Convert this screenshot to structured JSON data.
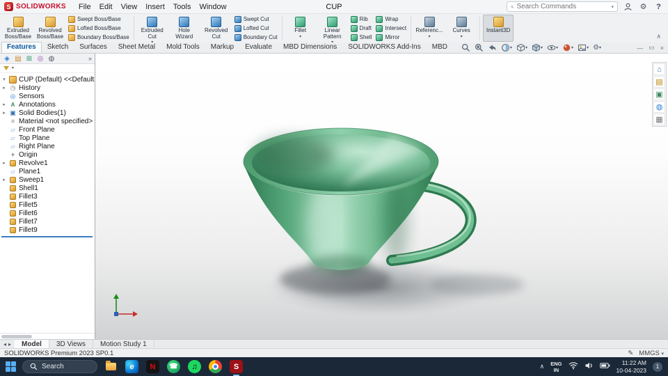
{
  "titlebar": {
    "app_name": "SOLIDWORKS",
    "menus": [
      "File",
      "Edit",
      "View",
      "Insert",
      "Tools",
      "Window"
    ],
    "doc_title": "CUP",
    "search_placeholder": "Search Commands",
    "help_label": "?"
  },
  "ribbon": {
    "large": {
      "extruded_boss": "Extruded Boss/Base",
      "revolved_boss": "Revolved Boss/Base",
      "extruded_cut": "Extruded Cut",
      "hole_wizard": "Hole Wizard",
      "revolved_cut": "Revolved Cut",
      "fillet": "Fillet",
      "linear_pattern": "Linear Pattern",
      "reference": "Referenc...",
      "curves": "Curves",
      "instant3d": "Instant3D"
    },
    "small": {
      "swept_boss": "Swept Boss/Base",
      "lofted_boss": "Lofted Boss/Base",
      "boundary_boss": "Boundary Boss/Base",
      "swept_cut": "Swept Cut",
      "lofted_cut": "Lofted Cut",
      "boundary_cut": "Boundary Cut",
      "rib": "Rib",
      "draft": "Draft",
      "shell": "Shell",
      "wrap": "Wrap",
      "intersect": "Intersect",
      "mirror": "Mirror"
    }
  },
  "tabs": {
    "items": [
      "Features",
      "Sketch",
      "Surfaces",
      "Sheet Metal",
      "Mold Tools",
      "Markup",
      "Evaluate",
      "MBD Dimensions",
      "SOLIDWORKS Add-Ins",
      "MBD"
    ]
  },
  "tree": {
    "root": "CUP (Default) <<Default>_Display St...",
    "items": [
      {
        "e": "▸",
        "t": "History"
      },
      {
        "e": "",
        "t": "Sensors"
      },
      {
        "e": "▸",
        "t": "Annotations"
      },
      {
        "e": "▸",
        "t": "Solid Bodies(1)"
      },
      {
        "e": "",
        "t": "Material <not specified>"
      },
      {
        "e": "",
        "t": "Front Plane"
      },
      {
        "e": "",
        "t": "Top Plane"
      },
      {
        "e": "",
        "t": "Right Plane"
      },
      {
        "e": "",
        "t": "Origin"
      },
      {
        "e": "▸",
        "t": "Revolve1"
      },
      {
        "e": "",
        "t": "Plane1"
      },
      {
        "e": "▸",
        "t": "Sweep1"
      },
      {
        "e": "",
        "t": "Shell1"
      },
      {
        "e": "",
        "t": "Fillet3"
      },
      {
        "e": "",
        "t": "Fillet5"
      },
      {
        "e": "",
        "t": "Fillet6"
      },
      {
        "e": "",
        "t": "Fillet7"
      },
      {
        "e": "",
        "t": "Fillet9"
      }
    ]
  },
  "bottom_tabs": {
    "items": [
      "Model",
      "3D Views",
      "Motion Study 1"
    ]
  },
  "statusbar": {
    "left": "SOLIDWORKS Premium 2023 SP0.1",
    "units": "MMGS"
  },
  "taskbar": {
    "search_label": "Search",
    "apps": [
      {
        "id": "file-explorer"
      },
      {
        "id": "edge",
        "glyph": "e"
      },
      {
        "id": "netflix",
        "glyph": "N"
      },
      {
        "id": "whatsapp",
        "glyph": "☎"
      },
      {
        "id": "spotify",
        "glyph": "♫"
      },
      {
        "id": "chrome"
      },
      {
        "id": "solidworks",
        "glyph": "S"
      }
    ],
    "tray": {
      "lang_top": "ENG",
      "lang_bottom": "IN",
      "time": "11:22 AM",
      "date": "10-04-2023",
      "badge": "1"
    }
  },
  "colors": {
    "accent_red": "#c8102e",
    "cup_green": "#6fbf92",
    "taskbar_bg": "#1b2838"
  }
}
